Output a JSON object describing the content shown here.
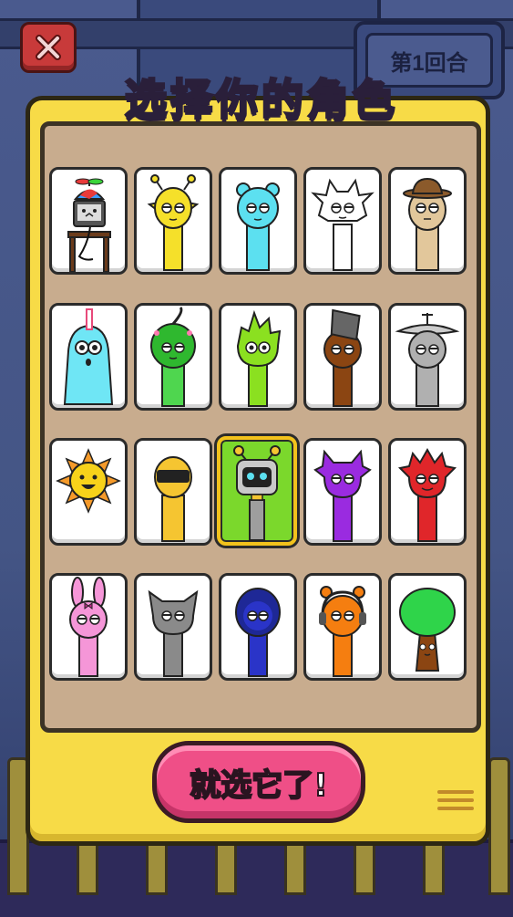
{
  "header": {
    "title_chars": [
      "选",
      "择",
      "你",
      "的",
      "角",
      "色"
    ],
    "title_colors": [
      "#ff4a4a",
      "#ff9a2a",
      "#f2d21a",
      "#5cd43a",
      "#3aa8ff",
      "#b05cff"
    ],
    "round_label": "第1回合",
    "close_icon": "close-x-icon"
  },
  "characters": [
    {
      "name": "robot-propeller",
      "color": "#555555"
    },
    {
      "name": "yellow-antenna",
      "color": "#f5e02a"
    },
    {
      "name": "cyan-bear",
      "color": "#5ce0f0"
    },
    {
      "name": "white-cat",
      "color": "#ffffff"
    },
    {
      "name": "tan-hat",
      "color": "#e2c79b"
    },
    {
      "name": "cyan-hair",
      "color": "#6fe6f5"
    },
    {
      "name": "green-leaf",
      "color": "#4fd64f"
    },
    {
      "name": "lime-spike",
      "color": "#8be020"
    },
    {
      "name": "brown-bucket",
      "color": "#8b4512"
    },
    {
      "name": "gray-dish",
      "color": "#b0b0b0"
    },
    {
      "name": "sun",
      "color": "#f7d21a"
    },
    {
      "name": "yellow-visor",
      "color": "#f5c531"
    },
    {
      "name": "green-robot",
      "color": "#9e9e9e"
    },
    {
      "name": "purple-horns",
      "color": "#9a2be0"
    },
    {
      "name": "red-spikes",
      "color": "#e0262a"
    },
    {
      "name": "pink-bunny",
      "color": "#f596d8"
    },
    {
      "name": "gray-cat",
      "color": "#8a8a8a"
    },
    {
      "name": "blue-hood",
      "color": "#2a34c8"
    },
    {
      "name": "orange-headphones",
      "color": "#f57e10"
    },
    {
      "name": "tree",
      "color": "#2fd44a"
    }
  ],
  "selected_index": 12,
  "confirm_button": {
    "label": "就选它了!"
  },
  "menu_icon": "menu-lines-icon"
}
